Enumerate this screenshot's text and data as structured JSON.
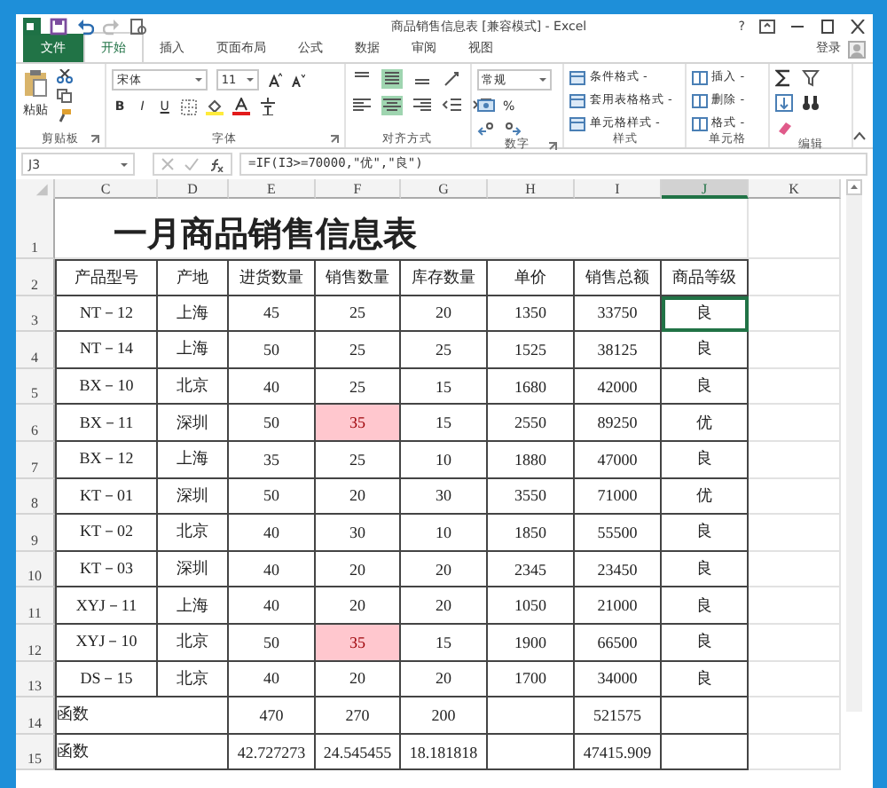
{
  "window": {
    "title": "商品销售信息表 [兼容模式] - Excel",
    "help": "?",
    "sign_in": "登录"
  },
  "ribbon_tabs": [
    {
      "label": "文件",
      "kind": "file",
      "selected": false
    },
    {
      "label": "开始",
      "kind": "tab",
      "selected": true
    },
    {
      "label": "插入",
      "kind": "tab",
      "selected": false
    },
    {
      "label": "页面布局",
      "kind": "tab",
      "selected": false
    },
    {
      "label": "公式",
      "kind": "tab",
      "selected": false
    },
    {
      "label": "数据",
      "kind": "tab",
      "selected": false
    },
    {
      "label": "审阅",
      "kind": "tab",
      "selected": false
    },
    {
      "label": "视图",
      "kind": "tab",
      "selected": false
    }
  ],
  "ribbon": {
    "paste": "粘贴",
    "font_name": "宋体",
    "font_size": "11",
    "bold": "B",
    "italic": "I",
    "underline": "U",
    "number_format": "常规",
    "percent": "%",
    "styles": [
      "条件格式 -",
      "套用表格格式 -",
      "单元格样式 -"
    ],
    "cells": [
      "插入 -",
      "删除 -",
      "格式 -"
    ],
    "groups": [
      "剪贴板",
      "字体",
      "对齐方式",
      "数字",
      "样式",
      "单元格",
      "编辑"
    ]
  },
  "formula_bar": {
    "name_box": "J3",
    "formula": "=IF(I3>=70000,\"优\",\"良\")"
  },
  "sheet": {
    "columns": [
      {
        "label": "C",
        "selected": false
      },
      {
        "label": "D",
        "selected": false
      },
      {
        "label": "E",
        "selected": false
      },
      {
        "label": "F",
        "selected": false
      },
      {
        "label": "G",
        "selected": false
      },
      {
        "label": "H",
        "selected": false
      },
      {
        "label": "I",
        "selected": false
      },
      {
        "label": "J",
        "selected": true
      },
      {
        "label": "K",
        "selected": false
      }
    ],
    "rows": [
      {
        "num": "1",
        "kind": "title",
        "text": "一月商品销售信息表"
      },
      {
        "num": "2",
        "kind": "header",
        "cells": [
          "产品型号",
          "产地",
          "进货数量",
          "销售数量",
          "库存数量",
          "单价",
          "销售总额",
          "商品等级"
        ]
      },
      {
        "num": "3",
        "kind": "data",
        "cells": [
          "NT－12",
          "上海",
          "45",
          "25",
          "20",
          "1350",
          "33750",
          {
            "text": "良",
            "selected": true
          }
        ]
      },
      {
        "num": "4",
        "kind": "data",
        "cells": [
          "NT－14",
          "上海",
          "50",
          "25",
          "25",
          "1525",
          "38125",
          "良"
        ]
      },
      {
        "num": "5",
        "kind": "data",
        "cells": [
          "BX－10",
          "北京",
          "40",
          "25",
          "15",
          "1680",
          "42000",
          "良"
        ]
      },
      {
        "num": "6",
        "kind": "data",
        "cells": [
          "BX－11",
          "深圳",
          "50",
          {
            "text": "35",
            "highlighted": true
          },
          "15",
          "2550",
          "89250",
          "优"
        ]
      },
      {
        "num": "7",
        "kind": "data",
        "cells": [
          "BX－12",
          "上海",
          "35",
          "25",
          "10",
          "1880",
          "47000",
          "良"
        ]
      },
      {
        "num": "8",
        "kind": "data",
        "cells": [
          "KT－01",
          "深圳",
          "50",
          "20",
          "30",
          "3550",
          "71000",
          "优"
        ]
      },
      {
        "num": "9",
        "kind": "data",
        "cells": [
          "KT－02",
          "北京",
          "40",
          "30",
          "10",
          "1850",
          "55500",
          "良"
        ]
      },
      {
        "num": "10",
        "kind": "data",
        "cells": [
          "KT－03",
          "深圳",
          "40",
          "20",
          "20",
          "2345",
          "23450",
          "良"
        ]
      },
      {
        "num": "11",
        "kind": "data",
        "cells": [
          "XYJ－11",
          "上海",
          "40",
          "20",
          "20",
          "1050",
          "21000",
          "良"
        ]
      },
      {
        "num": "12",
        "kind": "data",
        "cells": [
          "XYJ－10",
          "北京",
          "50",
          {
            "text": "35",
            "highlighted": true
          },
          "15",
          "1900",
          "66500",
          "良"
        ]
      },
      {
        "num": "13",
        "kind": "data",
        "cells": [
          "DS－15",
          "北京",
          "40",
          "20",
          "20",
          "1700",
          "34000",
          "良"
        ]
      },
      {
        "num": "14",
        "kind": "summary",
        "label": "函数",
        "purchased": "470",
        "sold": "270",
        "stock": "200",
        "total": "521575"
      },
      {
        "num": "15",
        "kind": "summary",
        "label": "函数",
        "purchased": "42.727273",
        "sold": "24.545455",
        "stock": "18.181818",
        "total": "47415.909"
      }
    ]
  }
}
